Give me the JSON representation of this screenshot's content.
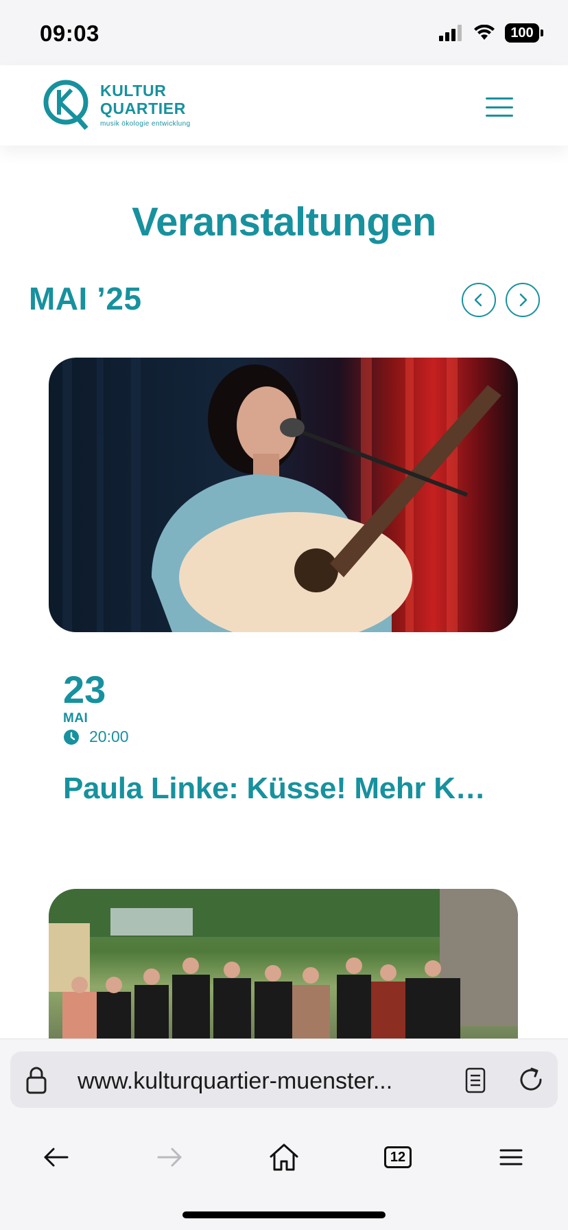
{
  "status_bar": {
    "time": "09:03",
    "battery_level": "100",
    "icons": [
      "signal-icon",
      "wifi-icon",
      "battery-icon"
    ]
  },
  "header": {
    "logo_line1": "KULTUR",
    "logo_line2": "QUARTIER",
    "logo_tagline": "musik ökologie entwicklung",
    "menu_icon": "hamburger-menu-icon",
    "accent_color": "#17919e"
  },
  "main": {
    "page_title": "Veranstaltungen",
    "month_label": "MAI ’25",
    "prev_icon": "chevron-left-icon",
    "next_icon": "chevron-right-icon",
    "events": [
      {
        "day": "23",
        "month": "MAI",
        "time": "20:00",
        "title": "Paula Linke: Küsse! Mehr Kü…",
        "image": "singer-with-guitar-photo"
      },
      {
        "image": "choir-group-photo"
      }
    ]
  },
  "browser": {
    "url": "www.kulturquartier-muenster...",
    "tabs_count": "12",
    "icons": [
      "lock-icon",
      "reader-icon",
      "reload-icon",
      "back-icon",
      "forward-icon",
      "home-icon",
      "tabs-icon",
      "menu-icon"
    ]
  }
}
